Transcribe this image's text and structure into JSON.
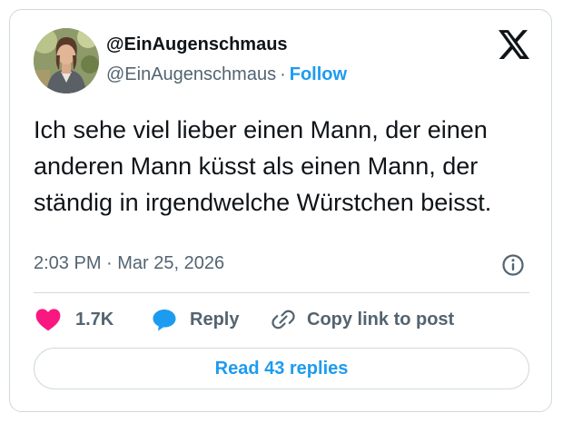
{
  "author": {
    "display_name": "@EinAugenschmaus",
    "handle": "@EinAugenschmaus",
    "separator": "·",
    "follow_label": "Follow",
    "avatar_icon": "profile-photo"
  },
  "brand": {
    "logo_icon": "x-logo",
    "color": "#0f1419"
  },
  "tweet": {
    "text": "Ich sehe viel lieber einen Mann, der einen anderen Mann küsst als einen Mann, der ständig in irgendwelche Würstchen beisst.",
    "timestamp": "2:03 PM · Mar 25, 2026"
  },
  "actions": {
    "like_count": "1.7K",
    "like_icon": "heart-icon",
    "like_color": "#f91880",
    "reply_label": "Reply",
    "reply_icon": "speech-bubble-icon",
    "reply_color": "#1d9bf0",
    "copy_label": "Copy link to post",
    "copy_icon": "link-icon"
  },
  "footer": {
    "read_replies_label": "Read 43 replies"
  },
  "colors": {
    "accent": "#1d9bf0",
    "text": "#0f1419",
    "secondary_text": "#536471",
    "border": "#cfd9de"
  }
}
